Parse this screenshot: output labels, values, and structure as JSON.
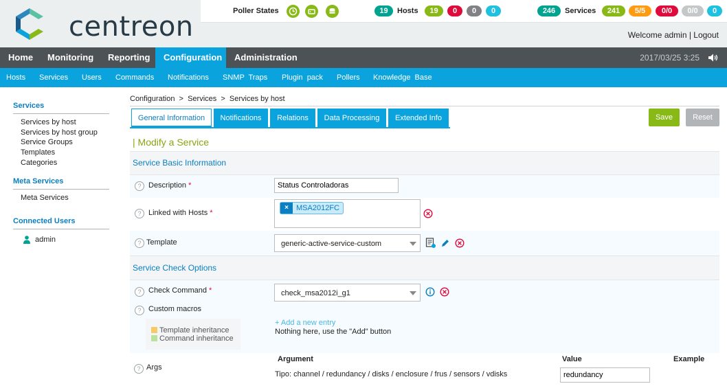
{
  "header": {
    "logo_text": "centreon",
    "poller_states_label": "Poller States",
    "hosts_label": "Hosts",
    "services_label": "Services",
    "hosts_counts": {
      "total": "19",
      "up": "19",
      "down": "0",
      "unreachable": "0",
      "pending": "0"
    },
    "services_counts": {
      "total": "246",
      "ok": "241",
      "warning": "5/5",
      "critical": "0/0",
      "unknown": "0/0",
      "pending": "0"
    },
    "welcome": "Welcome admin | Logout"
  },
  "main_menu": {
    "items": [
      "Home",
      "Monitoring",
      "Reporting",
      "Configuration",
      "Administration"
    ],
    "active": "Configuration",
    "datetime": "2017/03/25  3:25"
  },
  "sub_menu": {
    "items": [
      "Hosts",
      "Services",
      "Users",
      "Commands",
      "Notifications",
      "SNMP  Traps",
      "Plugin  pack",
      "Pollers",
      "Knowledge  Base"
    ]
  },
  "sidebar": {
    "services_title": "Services",
    "services_links": [
      "Services by host",
      "Services by host group",
      "Service Groups",
      "Templates",
      "Categories"
    ],
    "meta_title": "Meta Services",
    "meta_links": [
      "Meta Services"
    ],
    "connected_title": "Connected Users",
    "connected_users": [
      "admin"
    ]
  },
  "breadcrumb": "Configuration  >  Services  >  Services by host",
  "tabs": [
    "General Information",
    "Notifications",
    "Relations",
    "Data Processing",
    "Extended Info"
  ],
  "buttons": {
    "save": "Save",
    "reset": "Reset"
  },
  "form": {
    "title": "| Modify a Service",
    "basic_section": "Service Basic Information",
    "description_label": "Description",
    "description_value": "Status Controladoras",
    "linked_hosts_label": "Linked with Hosts",
    "linked_hosts": [
      "MSA2012FC"
    ],
    "template_label": "Template",
    "template_value": "generic-active-service-custom",
    "check_section": "Service Check Options",
    "check_command_label": "Check Command",
    "check_command_value": "check_msa2012i_g1",
    "custom_macros_label": "Custom macros",
    "template_inheritance": "Template inheritance",
    "command_inheritance": "Command inheritance",
    "add_entry": "+ Add a new entry",
    "nothing_here": "Nothing here, use the \"Add\" button",
    "args_label": "Args",
    "args_columns": {
      "argument": "Argument",
      "value": "Value",
      "example": "Example"
    },
    "arg_description": "Tipo: channel / redundancy / disks / enclosure / frus / sensors / vdisks",
    "arg_value": "redundancy",
    "required_mark": "*",
    "help_mark": "?"
  },
  "colors": {
    "accent_blue": "#0aa3dd",
    "menu_dark": "#4d5257",
    "ok_green": "#88b917",
    "title_green": "#88a511"
  }
}
